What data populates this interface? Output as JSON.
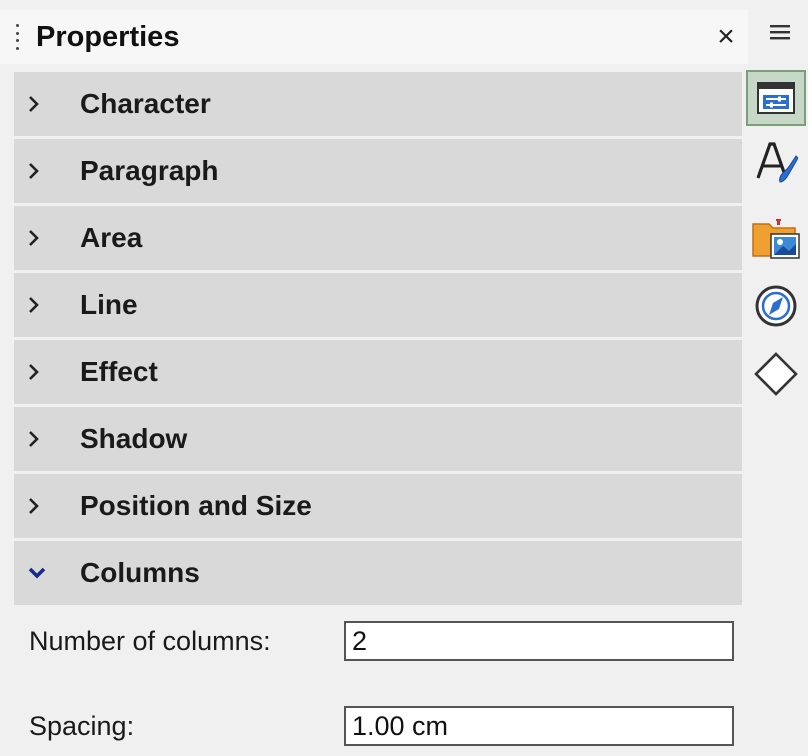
{
  "panel": {
    "title": "Properties",
    "close_glyph": "×"
  },
  "sections": [
    {
      "label": "Character",
      "expanded": false
    },
    {
      "label": "Paragraph",
      "expanded": false
    },
    {
      "label": "Area",
      "expanded": false
    },
    {
      "label": "Line",
      "expanded": false
    },
    {
      "label": "Effect",
      "expanded": false
    },
    {
      "label": "Shadow",
      "expanded": false
    },
    {
      "label": "Position and Size",
      "expanded": false
    },
    {
      "label": "Columns",
      "expanded": true
    }
  ],
  "columns": {
    "number_label": "Number of columns:",
    "number_value": "2",
    "spacing_label": "Spacing:",
    "spacing_value": "1.00 cm"
  },
  "sidebar_tabs": {
    "menu_icon": "hamburger-menu-icon",
    "tabs": [
      {
        "icon": "properties-icon",
        "active": true
      },
      {
        "icon": "styles-icon",
        "active": false
      },
      {
        "icon": "gallery-icon",
        "active": false
      },
      {
        "icon": "navigator-icon",
        "active": false
      },
      {
        "icon": "shapes-icon",
        "active": false
      }
    ]
  },
  "colors": {
    "expanded_chevron": "#1a2a8a",
    "section_bg": "#d9d9d9",
    "active_tab_bg": "#c8d8c8"
  }
}
